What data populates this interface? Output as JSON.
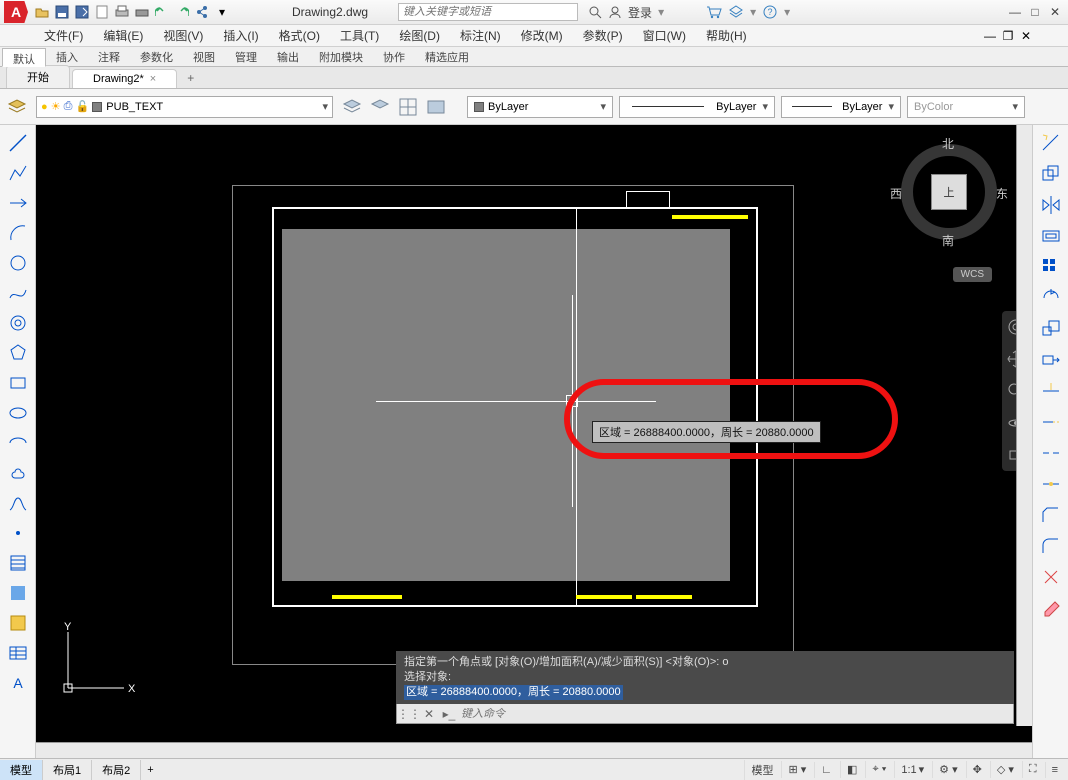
{
  "titlebar": {
    "filename": "Drawing2.dwg",
    "search_placeholder": "键入关键字或短语",
    "login": "登录"
  },
  "menus": [
    "文件(F)",
    "编辑(E)",
    "视图(V)",
    "插入(I)",
    "格式(O)",
    "工具(T)",
    "绘图(D)",
    "标注(N)",
    "修改(M)",
    "参数(P)",
    "窗口(W)",
    "帮助(H)"
  ],
  "ribbon_tabs": [
    "默认",
    "插入",
    "注释",
    "参数化",
    "视图",
    "管理",
    "输出",
    "附加模块",
    "协作",
    "精选应用"
  ],
  "ribbon_active": "默认",
  "doc_tabs": {
    "start": "开始",
    "active": "Drawing2*"
  },
  "properties": {
    "layer": "PUB_TEXT",
    "color": "ByLayer",
    "linetype": "ByLayer",
    "lineweight": "ByLayer",
    "plotstyle": "ByColor"
  },
  "viewcube": {
    "top": "上",
    "n": "北",
    "s": "南",
    "e": "东",
    "w": "西",
    "wcs": "WCS"
  },
  "tooltip": "区域 = 26888400.0000，周长 = 20880.0000",
  "cmd": {
    "line1": "指定第一个角点或 [对象(O)/增加面积(A)/减少面积(S)] <对象(O)>: o",
    "line2": "选择对象:",
    "line3": "区域 = 26888400.0000，周长 = 20880.0000",
    "placeholder": "键入命令"
  },
  "ucs": {
    "x": "X",
    "y": "Y"
  },
  "status": {
    "tabs": [
      "模型",
      "布局1",
      "布局2"
    ],
    "active": "模型",
    "model_btn": "模型",
    "scale": "1:1"
  }
}
